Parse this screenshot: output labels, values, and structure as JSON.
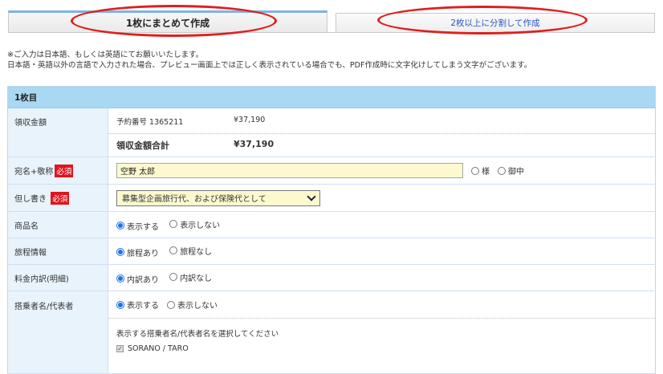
{
  "tabs": {
    "tab1_label": "1枚にまとめて作成",
    "tab2_label": "2枚以上に分割して作成"
  },
  "notice": {
    "line1": "※ご入力は日本語、もしくは英語にてお願いいたします。",
    "line2": "日本語・英語以外の言語で入力された場合、プレビュー画面上では正しく表示されている場合でも、PDF作成時に文字化けしてしまう文字がございます。"
  },
  "section": {
    "title": "1枚目"
  },
  "amount": {
    "label": "領収金額",
    "reservation_text": "予約番号 1365211",
    "reservation_amount": "¥37,190",
    "total_label": "領収金額合計",
    "total_amount": "¥37,190"
  },
  "recipient": {
    "label": "宛名+敬称",
    "required": "必須",
    "value": "空野 太郎",
    "opt1": "様",
    "opt2": "御中"
  },
  "proviso": {
    "label": "但し書き",
    "required": "必須",
    "selected": "募集型企画旅行代、および保険代として"
  },
  "product": {
    "label": "商品名",
    "opt_show": "表示する",
    "opt_hide": "表示しない"
  },
  "itinerary": {
    "label": "旅程情報",
    "opt_yes": "旅程あり",
    "opt_no": "旅程なし"
  },
  "breakdown": {
    "label": "料金内訳(明細)",
    "opt_yes": "内訳あり",
    "opt_no": "内訳なし"
  },
  "passenger": {
    "label": "搭乗者名/代表者",
    "opt_show": "表示する",
    "opt_hide": "表示しない",
    "instruction": "表示する搭乗者名/代表者名を選択してください",
    "name": "SORANO / TARO"
  }
}
